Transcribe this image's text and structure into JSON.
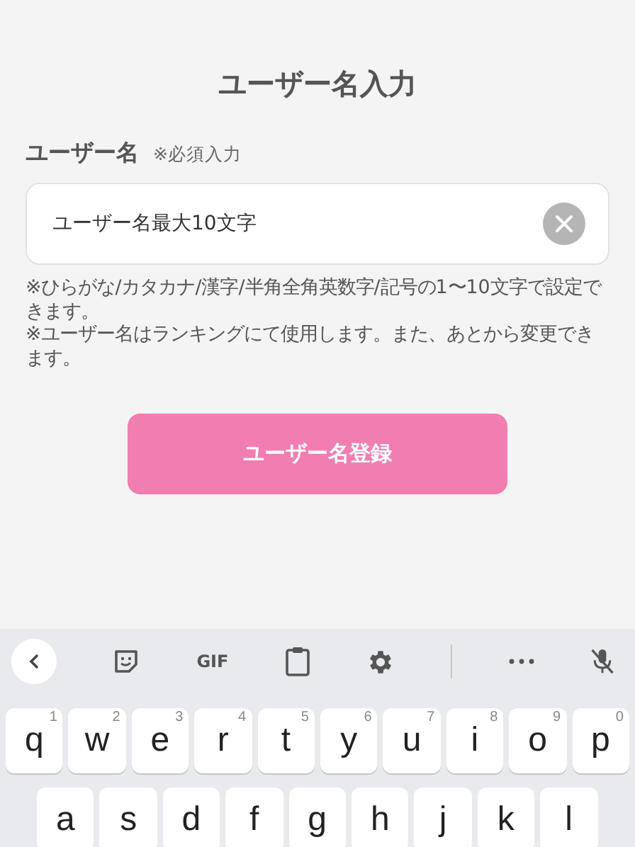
{
  "title": "ユーザー名入力",
  "field": {
    "label": "ユーザー名",
    "required_note": "※必須入力",
    "value": "ユーザー名最大10文字"
  },
  "notes": [
    "※ひらがな/カタカナ/漢字/半角全角英数字/記号の1〜10文字で設定できます。",
    "※ユーザー名はランキングにて使用します。また、あとから変更できます。"
  ],
  "submit_button": "ユーザー名登録",
  "keyboard": {
    "toolbar": [
      {
        "kind": "back"
      },
      {
        "kind": "sticker"
      },
      {
        "kind": "text",
        "label": "GIF"
      },
      {
        "kind": "clipboard"
      },
      {
        "kind": "settings"
      },
      {
        "kind": "divider"
      },
      {
        "kind": "more"
      },
      {
        "kind": "mic-off"
      }
    ],
    "rows": [
      [
        {
          "key": "q",
          "hint": "1"
        },
        {
          "key": "w",
          "hint": "2"
        },
        {
          "key": "e",
          "hint": "3"
        },
        {
          "key": "r",
          "hint": "4"
        },
        {
          "key": "t",
          "hint": "5"
        },
        {
          "key": "y",
          "hint": "6"
        },
        {
          "key": "u",
          "hint": "7"
        },
        {
          "key": "i",
          "hint": "8"
        },
        {
          "key": "o",
          "hint": "9"
        },
        {
          "key": "p",
          "hint": "0"
        }
      ],
      [
        {
          "key": "a"
        },
        {
          "key": "s"
        },
        {
          "key": "d"
        },
        {
          "key": "f"
        },
        {
          "key": "g"
        },
        {
          "key": "h"
        },
        {
          "key": "j"
        },
        {
          "key": "k"
        },
        {
          "key": "l"
        }
      ]
    ]
  }
}
